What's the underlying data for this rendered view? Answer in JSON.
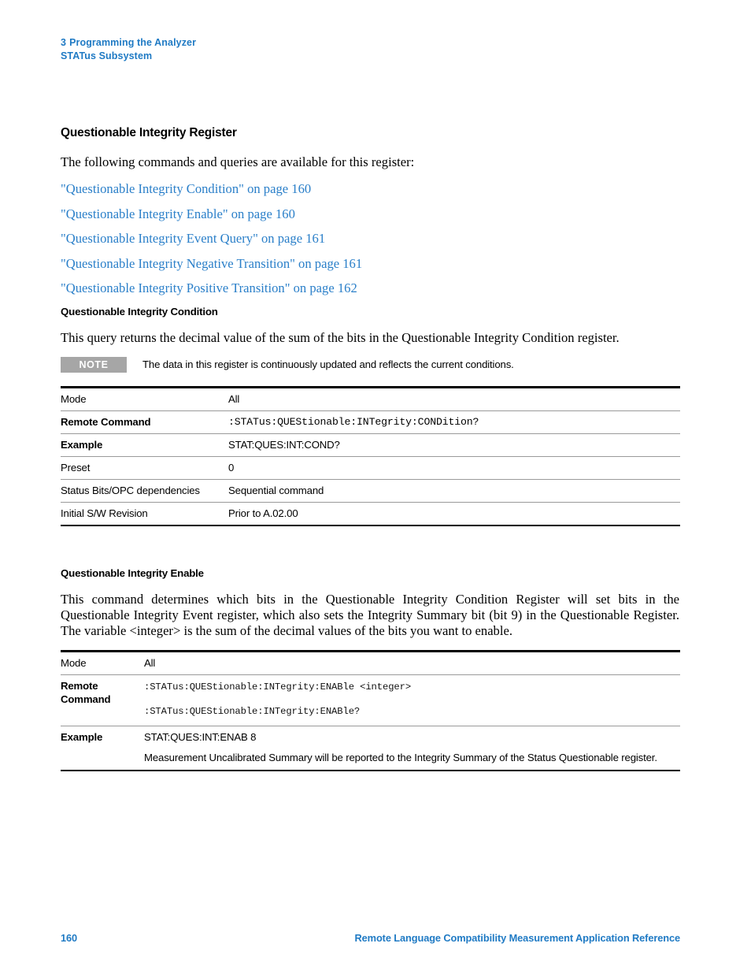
{
  "header": {
    "chapter_number": "3",
    "chapter_title": "Programming the Analyzer",
    "subsystem": "STATus Subsystem"
  },
  "colors": {
    "link_blue": "#2a7fc9",
    "header_blue": "#1f7ac4",
    "note_badge_gray": "#a6a6a6",
    "rule_gray": "#9a9a9a",
    "rule_black": "#000000"
  },
  "section": {
    "title": "Questionable Integrity Register",
    "intro": "The following commands and queries are available for this register:",
    "links": [
      "\"Questionable Integrity Condition\" on page 160",
      "\"Questionable Integrity Enable\" on page 160",
      "\"Questionable Integrity Event Query\" on page 161",
      "\"Questionable Integrity Negative Transition\" on page 161",
      "\"Questionable Integrity Positive Transition\" on page 162"
    ]
  },
  "condition": {
    "title": "Questionable Integrity Condition",
    "description": "This query returns the decimal value of the sum of the bits in the Questionable Integrity Condition register.",
    "note": {
      "label": "NOTE",
      "text": "The data in this register is continuously updated and reflects the current conditions."
    },
    "table": {
      "rows": [
        {
          "key": "Mode",
          "key_bold": false,
          "value": "All",
          "mono": false
        },
        {
          "key": "Remote Command",
          "key_bold": true,
          "value": ":STATus:QUEStionable:INTegrity:CONDition?",
          "mono": true
        },
        {
          "key": "Example",
          "key_bold": true,
          "value": "STAT:QUES:INT:COND?",
          "mono": false
        },
        {
          "key": "Preset",
          "key_bold": false,
          "value": "0",
          "mono": false
        },
        {
          "key": "Status Bits/OPC dependencies",
          "key_bold": false,
          "value": "Sequential command",
          "mono": false
        },
        {
          "key": "Initial S/W Revision",
          "key_bold": false,
          "value": "Prior to A.02.00",
          "mono": false
        }
      ]
    }
  },
  "enable": {
    "title": "Questionable Integrity Enable",
    "description": "This command determines which bits in the Questionable Integrity Condition Register will set bits in the Questionable Integrity Event register, which also sets the Integrity Summary bit (bit 9) in the Questionable Register. The variable <integer> is the sum of the decimal values of the bits you want to enable.",
    "table": {
      "mode_key": "Mode",
      "mode_value": "All",
      "remote_key_line1": "Remote",
      "remote_key_line2": "Command",
      "remote_command_set": ":STATus:QUEStionable:INTegrity:ENABle <integer>",
      "remote_command_query": ":STATus:QUEStionable:INTegrity:ENABle?",
      "example_key": "Example",
      "example_value": "STAT:QUES:INT:ENAB 8",
      "example_note": "Measurement Uncalibrated Summary will be reported to the Integrity Summary of the Status Questionable register."
    }
  },
  "footer": {
    "page_number": "160",
    "document_title": "Remote Language Compatibility Measurement Application Reference"
  }
}
